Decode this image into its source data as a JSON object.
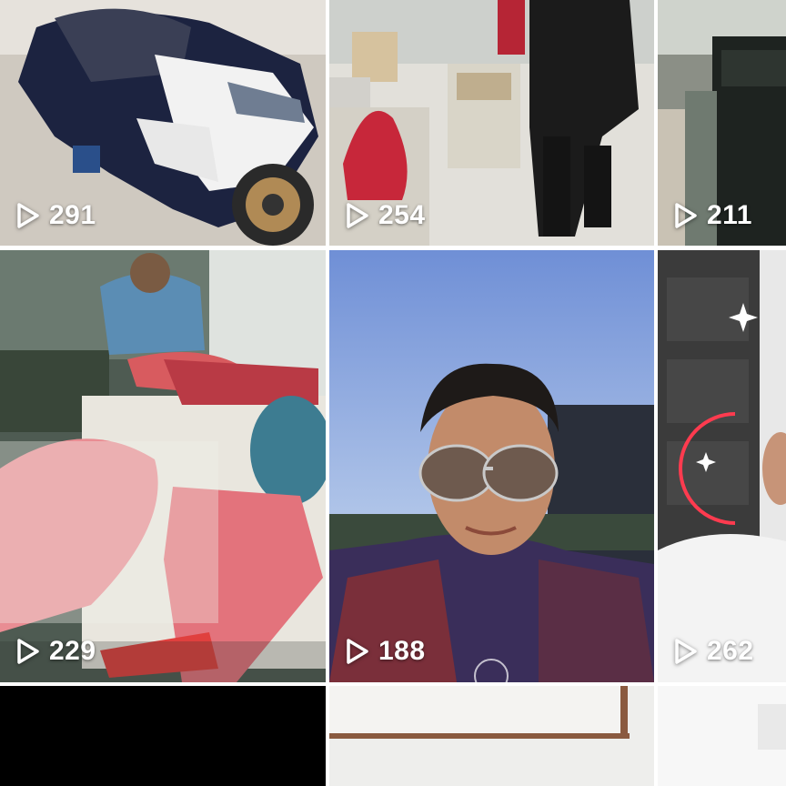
{
  "videos": [
    {
      "id_label": "motorcycle",
      "views": "291"
    },
    {
      "id_label": "fish-market-boxes",
      "views": "254"
    },
    {
      "id_label": "storage-containers",
      "views": "211"
    },
    {
      "id_label": "man-cutting-tuna",
      "views": "229"
    },
    {
      "id_label": "selfie-sunglasses",
      "views": "188"
    },
    {
      "id_label": "man-white-shirt",
      "views": "262"
    },
    {
      "id_label": "black-tile",
      "views": ""
    },
    {
      "id_label": "white-room",
      "views": ""
    },
    {
      "id_label": "bright-tile",
      "views": ""
    }
  ],
  "icons": {
    "play": "play-outline-icon"
  },
  "colors": {
    "overlay_text": "#ffffff",
    "grid_gap": "#ffffff"
  }
}
